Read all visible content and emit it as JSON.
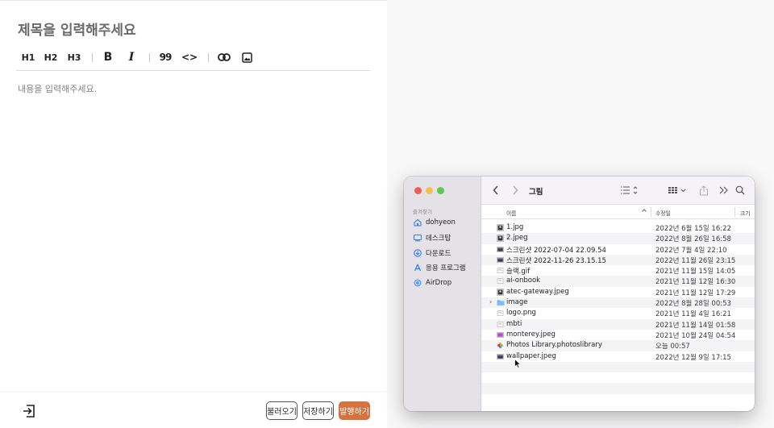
{
  "editor": {
    "title_placeholder": "제목을 입력해주세요",
    "content_placeholder": "내용을 입력해주세요.",
    "toolbar": {
      "h1": "H1",
      "h2": "H2",
      "h3": "H3",
      "bold": "B",
      "italic": "I",
      "quote": "99",
      "code": "<>"
    },
    "footer": {
      "load_label": "불러오기",
      "save_label": "저장하기",
      "publish_label": "발행하기"
    }
  },
  "finder": {
    "folder_title": "그림",
    "sidebar": {
      "section_label": "즐겨찾기",
      "items": [
        {
          "label": "dohyeon",
          "icon": "home-icon"
        },
        {
          "label": "데스크탑",
          "icon": "desktop-icon"
        },
        {
          "label": "다운로드",
          "icon": "download-icon"
        },
        {
          "label": "응용 프로그램",
          "icon": "applications-icon"
        },
        {
          "label": "AirDrop",
          "icon": "airdrop-icon"
        }
      ]
    },
    "columns": {
      "name": "이름",
      "modified": "수정일",
      "size": "크기"
    },
    "files": [
      {
        "name": "1.jpg",
        "date": "2022년 6월 15일 16:22",
        "type": "image"
      },
      {
        "name": "2.jpeg",
        "date": "2022년 8월 26일 16:58",
        "type": "image"
      },
      {
        "name": "스크린샷 2022-07-04 22.09.54",
        "date": "2022년 7월 4일 22:10",
        "type": "screenshot"
      },
      {
        "name": "스크린샷 2022-11-26 23.15.15",
        "date": "2022년 11월 26일 23:15",
        "type": "screenshot"
      },
      {
        "name": "슬랙.gif",
        "date": "2021년 11월 15일 14:05",
        "type": "doc"
      },
      {
        "name": "ai-onbook",
        "date": "2021년 11월 12일 16:30",
        "type": "doc"
      },
      {
        "name": "atec-gateway.jpeg",
        "date": "2021년 11월 12일 17:29",
        "type": "image"
      },
      {
        "name": "image",
        "date": "2022년 8월 28일 00:53",
        "type": "folder"
      },
      {
        "name": "logo.png",
        "date": "2021년 11월 4일 16:21",
        "type": "doc"
      },
      {
        "name": "mbti",
        "date": "2021년 11월 14일 01:58",
        "type": "doc"
      },
      {
        "name": "monterey.jpeg",
        "date": "2021년 10월 24일 04:54",
        "type": "purple"
      },
      {
        "name": "Photos Library.photoslibrary",
        "date": "오늘 00:57",
        "type": "photos"
      },
      {
        "name": "wallpaper.jpeg",
        "date": "2022년 12월 9일 17:15",
        "type": "screenshot"
      }
    ]
  },
  "colors": {
    "publish_accent": "#d3733f",
    "finder_accent": "#2f7cf6"
  }
}
